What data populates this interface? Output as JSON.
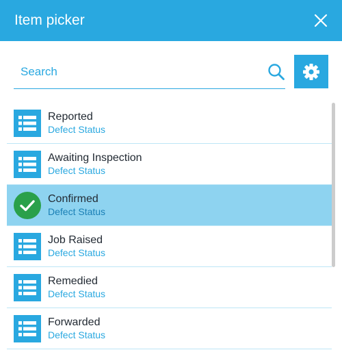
{
  "header": {
    "title": "Item picker",
    "close_icon": "close-icon"
  },
  "search": {
    "placeholder": "Search",
    "value": "",
    "search_icon": "search-icon",
    "settings_icon": "gear-icon"
  },
  "colors": {
    "accent": "#29a8e0",
    "selected_row": "#8ed3f0",
    "check": "#2aa04a"
  },
  "items": [
    {
      "title": "Reported",
      "subtitle": "Defect Status",
      "icon": "list-icon",
      "selected": false
    },
    {
      "title": "Awaiting Inspection",
      "subtitle": "Defect Status",
      "icon": "list-icon",
      "selected": false
    },
    {
      "title": "Confirmed",
      "subtitle": "Defect Status",
      "icon": "check-circle-icon",
      "selected": true
    },
    {
      "title": "Job Raised",
      "subtitle": "Defect Status",
      "icon": "list-icon",
      "selected": false
    },
    {
      "title": "Remedied",
      "subtitle": "Defect Status",
      "icon": "list-icon",
      "selected": false
    },
    {
      "title": "Forwarded",
      "subtitle": "Defect Status",
      "icon": "list-icon",
      "selected": false
    }
  ]
}
